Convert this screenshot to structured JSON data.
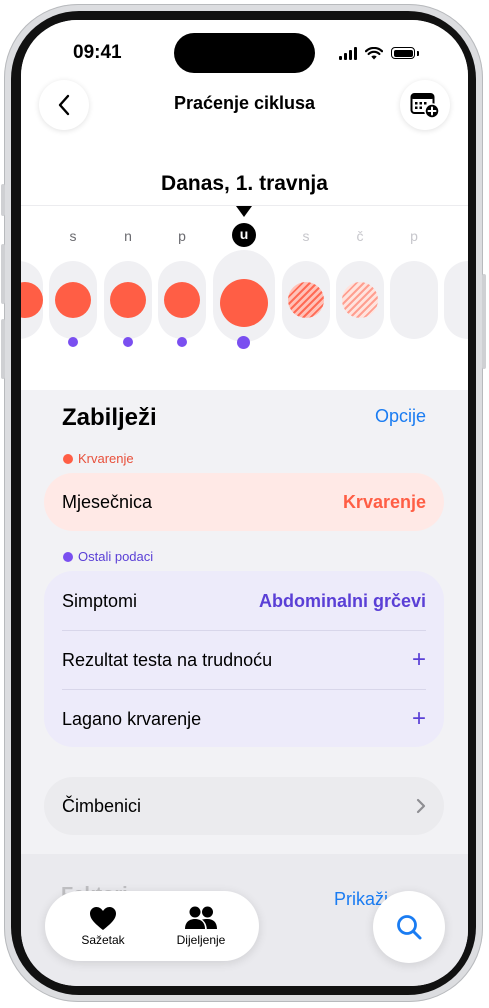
{
  "status_bar": {
    "time": "09:41"
  },
  "header": {
    "title": "Praćenje ciklusa",
    "date": "Danas, 1. travnja"
  },
  "calendar": {
    "days": [
      {
        "letter": "s"
      },
      {
        "letter": "n"
      },
      {
        "letter": "p"
      },
      {
        "letter": "u"
      },
      {
        "letter": "s"
      },
      {
        "letter": "č"
      },
      {
        "letter": "p"
      }
    ]
  },
  "log_section": {
    "title": "Zabilježi",
    "options_link": "Opcije",
    "bleeding_label": "Krvarenje",
    "menstruation": {
      "label": "Mjesečnica",
      "value": "Krvarenje"
    },
    "other_label": "Ostali podaci",
    "symptoms": {
      "label": "Simptomi",
      "value": "Abdominalni grčevi"
    },
    "pregnancy_test": {
      "label": "Rezultat testa na trudnoću",
      "action": "+"
    },
    "spotting": {
      "label": "Lagano krvarenje",
      "action": "+"
    },
    "factors": {
      "label": "Čimbenici"
    }
  },
  "lower": {
    "show_link": "Prikaži",
    "faded_text": "Faktori"
  },
  "tab_bar": {
    "summary": "Sažetak",
    "sharing": "Dijeljenje"
  },
  "colors": {
    "period": "#ff5e45",
    "other_data": "#7a4ff0",
    "accent": "#1a7cf2",
    "bleeding_card": "#ffe9e6",
    "other_card": "#edebfa"
  },
  "icons": {
    "back": "chevron-left-icon",
    "calendar_add": "calendar-add-icon",
    "factors_chevron": "chevron-right-icon",
    "summary": "heart-icon",
    "sharing": "people-icon",
    "search": "search-icon"
  }
}
